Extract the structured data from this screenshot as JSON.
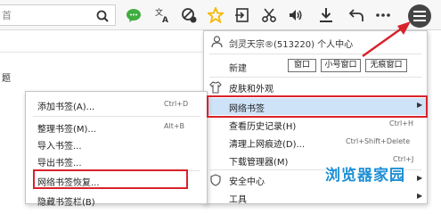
{
  "colors": {
    "accent_red": "#d8232a",
    "highlight_blue": "#cfe3f8",
    "watermark_blue": "#1e8fd6",
    "green_icon": "#3fae3f",
    "star_yellow": "#f5b800"
  },
  "toolbar": {
    "url_fragment": "首",
    "icons": [
      "search-icon",
      "chat-icon",
      "translate-icon",
      "block-icon",
      "star-icon",
      "export-icon",
      "scissors-icon",
      "speaker-icon",
      "download-icon",
      "undo-icon",
      "more-icon",
      "menu-icon"
    ]
  },
  "background": {
    "fragment_text": "题"
  },
  "main_menu": {
    "user_label": "剑灵天宗®(513220) 个人中心",
    "new_label": "新建",
    "window_buttons": [
      "窗口",
      "小号窗口",
      "无痕窗口"
    ],
    "items": [
      {
        "label": "皮肤和外观",
        "shortcut": "",
        "has_submenu": false
      },
      {
        "label": "网络书签",
        "shortcut": "",
        "has_submenu": true,
        "highlighted": true
      },
      {
        "label": "查看历史记录(H)",
        "shortcut": "Ctrl+H",
        "has_submenu": false
      },
      {
        "label": "清理上网痕迹(D)...",
        "shortcut": "Ctrl+Shift+Delete",
        "has_submenu": false
      },
      {
        "label": "下载管理器(M)",
        "shortcut": "Ctrl+J",
        "has_submenu": false
      },
      {
        "label": "安全中心",
        "shortcut": "",
        "has_submenu": true
      },
      {
        "label": "工具",
        "shortcut": "",
        "has_submenu": true
      }
    ]
  },
  "sub_menu": {
    "items": [
      {
        "label": "添加书签(A)...",
        "shortcut": "Ctrl+D"
      },
      {
        "label": "整理书签(M)...",
        "shortcut": "Alt+B"
      },
      {
        "label": "导入书签...",
        "shortcut": ""
      },
      {
        "label": "导出书签...",
        "shortcut": ""
      },
      {
        "label": "网络书签恢复...",
        "shortcut": ""
      },
      {
        "label": "隐藏书签栏(B)",
        "shortcut": ""
      }
    ]
  },
  "watermark": "浏览器家园"
}
